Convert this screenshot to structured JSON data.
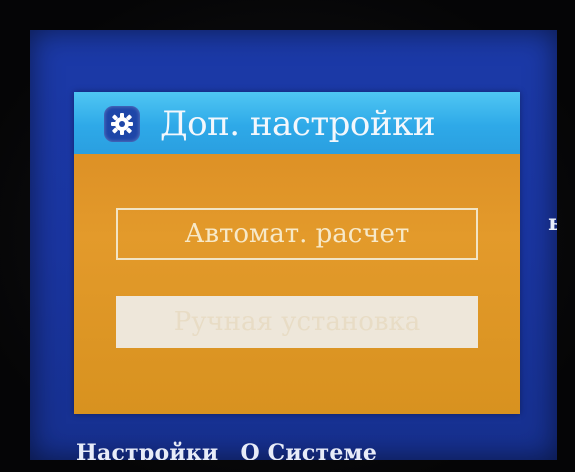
{
  "background": {
    "right_fragment": "ы",
    "bottom_bar": {
      "left_label": "Настройки",
      "right_label": "О Системе"
    }
  },
  "dialog": {
    "icon": "gear-icon",
    "title": "Доп. настройки",
    "items": [
      {
        "label": "Автомат. расчет",
        "state": "outlined"
      },
      {
        "label": "Ручная установка",
        "state": "highlighted"
      }
    ]
  },
  "colors": {
    "screen_bg": "#1b3aa8",
    "dialog_bg": "#e39a2b",
    "title_bar": "#2ea9e8",
    "highlight": "#eee7da"
  }
}
